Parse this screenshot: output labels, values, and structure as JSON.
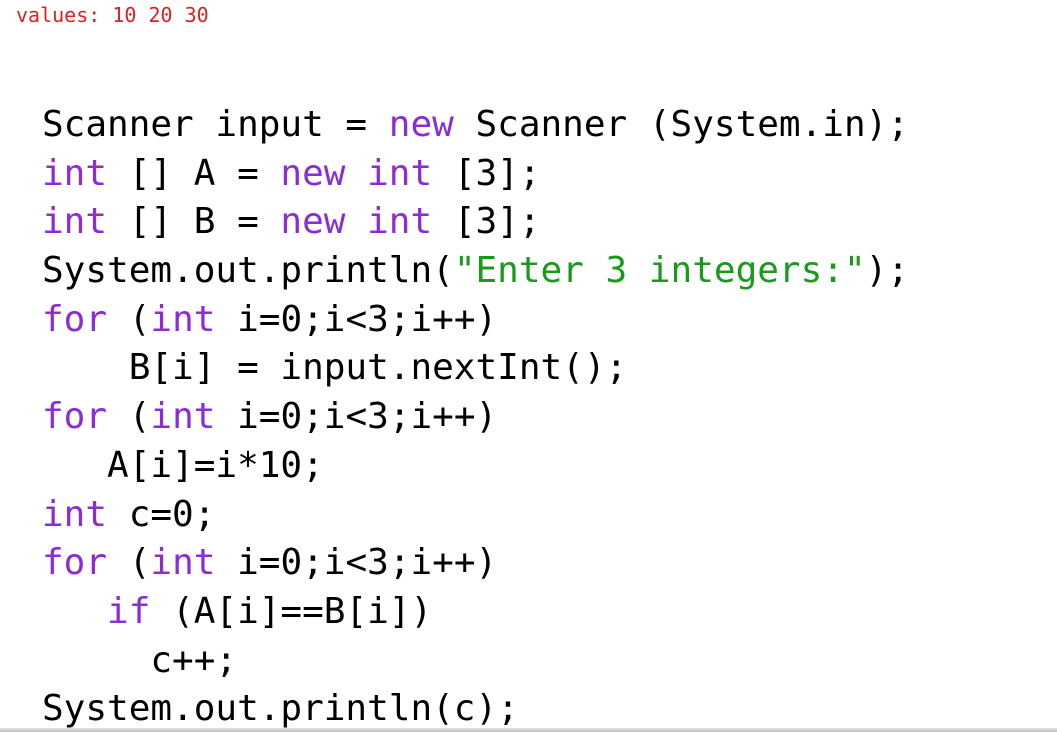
{
  "header": {
    "note": "values: 10 20 30"
  },
  "code": {
    "lines": [
      [
        {
          "t": "Scanner input = ",
          "c": "plain"
        },
        {
          "t": "new",
          "c": "kw"
        },
        {
          "t": " Scanner (System.in);",
          "c": "plain"
        }
      ],
      [
        {
          "t": "int",
          "c": "kw"
        },
        {
          "t": " [] A = ",
          "c": "plain"
        },
        {
          "t": "new int",
          "c": "kw"
        },
        {
          "t": " [3];",
          "c": "plain"
        }
      ],
      [
        {
          "t": "int",
          "c": "kw"
        },
        {
          "t": " [] B = ",
          "c": "plain"
        },
        {
          "t": "new int",
          "c": "kw"
        },
        {
          "t": " [3];",
          "c": "plain"
        }
      ],
      [
        {
          "t": "System.out.println(",
          "c": "plain"
        },
        {
          "t": "\"Enter 3 integers:\"",
          "c": "str"
        },
        {
          "t": ");",
          "c": "plain"
        }
      ],
      [
        {
          "t": "for",
          "c": "kw"
        },
        {
          "t": " (",
          "c": "plain"
        },
        {
          "t": "int",
          "c": "kw"
        },
        {
          "t": " i=0;i<3;i++)",
          "c": "plain"
        }
      ],
      [
        {
          "t": "    B[i] = input.nextInt();",
          "c": "plain"
        }
      ],
      [
        {
          "t": "for",
          "c": "kw"
        },
        {
          "t": " (",
          "c": "plain"
        },
        {
          "t": "int",
          "c": "kw"
        },
        {
          "t": " i=0;i<3;i++)",
          "c": "plain"
        }
      ],
      [
        {
          "t": "   A[i]=i*10;",
          "c": "plain"
        }
      ],
      [
        {
          "t": "int",
          "c": "kw"
        },
        {
          "t": " c=0;",
          "c": "plain"
        }
      ],
      [
        {
          "t": "for",
          "c": "kw"
        },
        {
          "t": " (",
          "c": "plain"
        },
        {
          "t": "int",
          "c": "kw"
        },
        {
          "t": " i=0;i<3;i++)",
          "c": "plain"
        }
      ],
      [
        {
          "t": "   ",
          "c": "plain"
        },
        {
          "t": "if",
          "c": "kw"
        },
        {
          "t": " (A[i]==B[i])",
          "c": "plain"
        }
      ],
      [
        {
          "t": "     c++;",
          "c": "plain"
        }
      ],
      [
        {
          "t": "System.out.println(c);",
          "c": "plain"
        }
      ]
    ]
  },
  "colors": {
    "keyword": "#8b2bd9",
    "string": "#1a9a1a",
    "note": "#e02020",
    "text": "#000000"
  }
}
